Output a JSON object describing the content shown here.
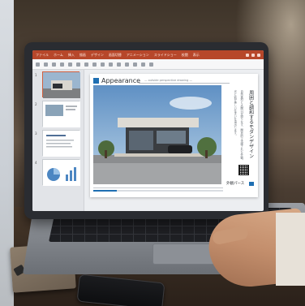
{
  "app": {
    "title_tabs": [
      "ファイル",
      "ホーム",
      "挿入",
      "描画",
      "デザイン",
      "画面切替",
      "アニメーション",
      "スライドショー",
      "校閲",
      "表示"
    ]
  },
  "thumbnails": [
    {
      "num": "1"
    },
    {
      "num": "2"
    },
    {
      "num": "3"
    },
    {
      "num": "4"
    }
  ],
  "slide": {
    "title": "Appearance",
    "subtitle": "— outside perspective drawing —",
    "heading_jp": "周囲と調和するモダンデザイン",
    "body_jp_1": "自然素材と大開口が織りなす、開放的で洗練された外観。",
    "body_jp_2": "光と影が美しい住まいを演出します。",
    "footer_label": "外観パース",
    "progress_fraction": 0.18
  },
  "colors": {
    "ribbon_accent": "#b7472a",
    "slide_accent": "#1f6fb2"
  }
}
